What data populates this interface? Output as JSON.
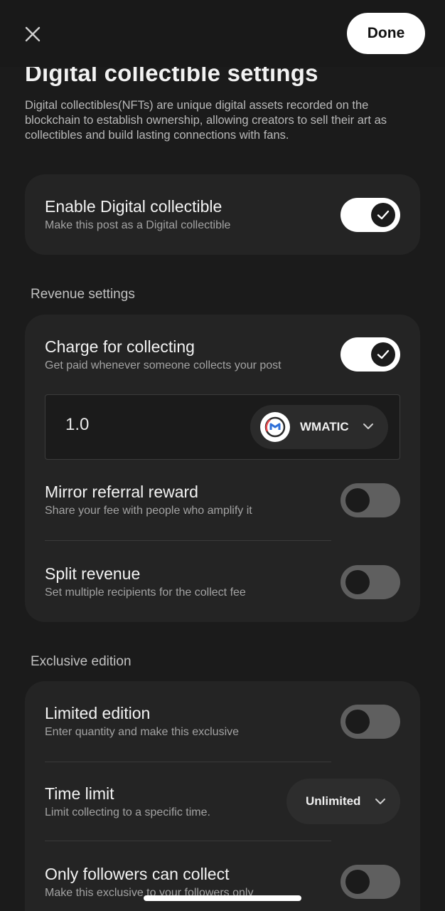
{
  "header": {
    "close_icon": "close-icon",
    "done_label": "Done"
  },
  "page": {
    "title": "Digital collectible settings",
    "description": "Digital collectibles(NFTs) are unique digital assets recorded on the blockchain to establish ownership, allowing creators to sell their art as collectibles and build lasting connections with fans."
  },
  "enable": {
    "title": "Enable Digital collectible",
    "subtitle": "Make this post as a Digital collectible",
    "enabled": true
  },
  "revenue": {
    "section_label": "Revenue settings",
    "charge": {
      "title": "Charge for collecting",
      "subtitle": "Get paid whenever someone collects your post",
      "enabled": true
    },
    "price": {
      "value": "1.0",
      "token": "WMATIC",
      "token_icon": "wmatic-logo-icon"
    },
    "mirror": {
      "title": "Mirror referral reward",
      "subtitle": "Share your fee with people who amplify it",
      "enabled": false
    },
    "split": {
      "title": "Split revenue",
      "subtitle": "Set multiple recipients for the collect fee",
      "enabled": false
    }
  },
  "exclusive": {
    "section_label": "Exclusive edition",
    "limited": {
      "title": "Limited edition",
      "subtitle": "Enter quantity and make this exclusive",
      "enabled": false
    },
    "time_limit": {
      "title": "Time limit",
      "subtitle": "Limit collecting to a specific time.",
      "value": "Unlimited"
    },
    "followers": {
      "title": "Only followers can collect",
      "subtitle": "Make this exclusive to your followers only",
      "enabled": false
    }
  },
  "colors": {
    "background": "#1b1b1b",
    "card": "#242424",
    "toggle_on": "#ffffff",
    "toggle_off": "#5f5f5f"
  }
}
